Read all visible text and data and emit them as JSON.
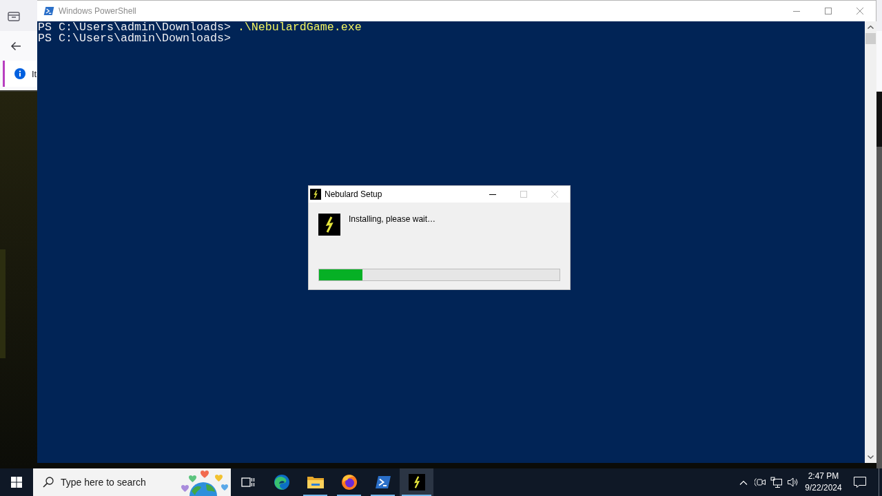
{
  "browser": {
    "notification_text": "It"
  },
  "powershell": {
    "title": "Windows PowerShell",
    "lines": [
      {
        "prompt": "PS C:\\Users\\admin\\Downloads>",
        "command": ".\\NebulardGame.exe"
      },
      {
        "prompt": "PS C:\\Users\\admin\\Downloads>"
      }
    ]
  },
  "setup_dialog": {
    "title": "Nebulard Setup",
    "buttons": [
      {
        "kind": "minimize",
        "disabled": false
      },
      {
        "kind": "maximize",
        "disabled": true
      },
      {
        "kind": "close",
        "disabled": true
      }
    ],
    "message": "Installing, please wait…",
    "progress": {
      "level": 0.18
    }
  },
  "taskbar": {
    "search": {
      "placeholder": "Type here to search"
    },
    "apps": [
      {
        "kind": "swirl",
        "running": false,
        "selected": false
      },
      {
        "kind": "folder",
        "running": true,
        "selected": false
      },
      {
        "kind": "fox",
        "running": true,
        "selected": false
      },
      {
        "kind": "terminal",
        "running": true,
        "selected": false
      },
      {
        "kind": "bolt",
        "running": true,
        "selected": true
      }
    ],
    "clock": {
      "time": "2:47 PM",
      "date": "9/22/2024"
    }
  }
}
